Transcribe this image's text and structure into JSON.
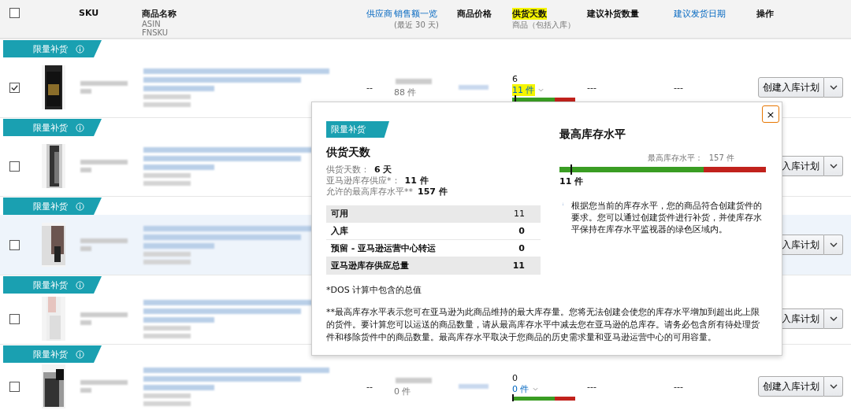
{
  "columns": [
    {
      "kind": "checkbox",
      "checked": false
    },
    {
      "kind": "text",
      "label": "SKU",
      "highlighted": false
    },
    {
      "kind": "text",
      "label": "商品名称",
      "sublabels": [
        "ASIN",
        "FNSKU"
      ],
      "highlighted": false
    },
    {
      "kind": "link",
      "label": "供应商",
      "highlighted": false
    },
    {
      "kind": "link",
      "label": "销售额一览",
      "sublabels": [
        "(最近 30 天)"
      ],
      "highlighted": false
    },
    {
      "kind": "text",
      "label": "商品价格",
      "highlighted": false
    },
    {
      "kind": "text",
      "label": "供货天数",
      "sublabels": [
        "商品（包括入库）"
      ],
      "highlighted": true
    },
    {
      "kind": "text",
      "label": "建议补货数量",
      "highlighted": false
    },
    {
      "kind": "link",
      "label": "建议发货日期",
      "highlighted": false
    },
    {
      "kind": "text",
      "label": "操作",
      "highlighted": false
    }
  ],
  "items": [
    {
      "badge": "限量补货",
      "checked": true,
      "highlighted": false,
      "supplier": "--",
      "sales_units": "88 件",
      "days": "6",
      "units": "11 件",
      "units_highlighted": true,
      "level": 0.04,
      "suggested_qty": "---",
      "ship_date": "---",
      "action": "创建入库计划"
    },
    {
      "badge": "限量补货",
      "checked": false,
      "highlighted": false,
      "action": "入库计划"
    },
    {
      "badge": "限量补货",
      "checked": false,
      "highlighted": true,
      "action": "入库计划"
    },
    {
      "badge": "限量补货",
      "checked": false,
      "highlighted": false,
      "action": "入库计划"
    },
    {
      "badge": "限量补货",
      "checked": false,
      "highlighted": false,
      "supplier": "--",
      "sales_units": "0 件",
      "days": "0",
      "units": "0 件",
      "units_highlighted": false,
      "level": 0,
      "suggested_qty": "---",
      "ship_date": "---",
      "action": "创建入库计划"
    }
  ],
  "popover": {
    "badge": "限量补货",
    "title": "供货天数",
    "facts": [
      {
        "label": "供货天数：",
        "value": "6 天"
      },
      {
        "label": "亚马逊库存供应*：",
        "value": "11 件"
      },
      {
        "label": "允许的最高库存水平**",
        "value": "157 件"
      }
    ],
    "breakdown": [
      {
        "label": "可用",
        "value": "11",
        "shaded": true,
        "bold": false
      },
      {
        "label": "入库",
        "value": "0",
        "shaded": false,
        "bold": true
      },
      {
        "label": "预留 - 亚马逊运营中心转运",
        "value": "0",
        "shaded": false,
        "bold": true
      },
      {
        "label": "亚马逊库存供应总量",
        "value": "11",
        "shaded": true,
        "bold": true
      }
    ],
    "level_title": "最高库存水平",
    "level_label": "最高库存水平：",
    "level_max": "157 件",
    "level": 0.055,
    "level_value": "11 件",
    "info": "根据您当前的库存水平，您的商品符合创建货件的要求。您可以通过创建货件进行补货，并使库存水平保持在库存水平监视器的绿色区域内。",
    "notes": [
      "*DOS 计算中包含的总值",
      "**最高库存水平表示您可在亚马逊为此商品维持的最大库存量。您将无法创建会使您的库存水平增加到超出此上限的货件。要计算您可以运送的商品数量，请从最高库存水平中减去您在亚马逊的总库存。请务必包含所有待处理货件和移除货件中的商品数量。最高库存水平取决于您商品的历史需求量和亚马逊运营中心的可用容量。"
    ],
    "close": "×"
  }
}
